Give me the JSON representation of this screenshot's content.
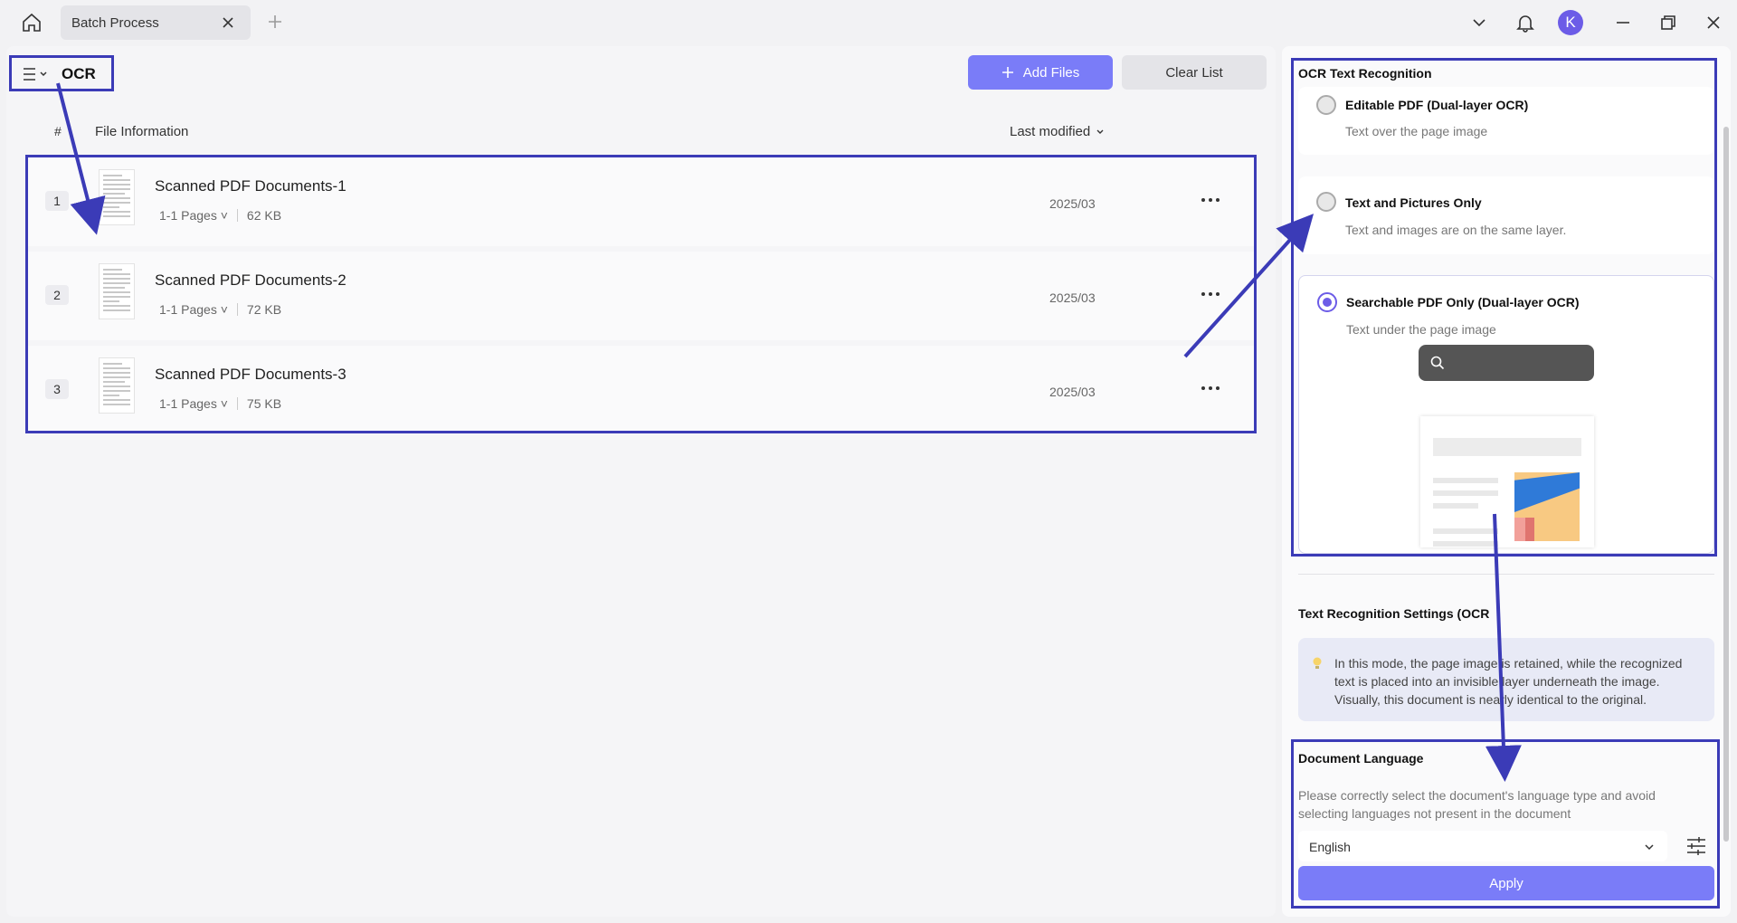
{
  "titlebar": {
    "tab_label": "Batch Process",
    "avatar_initial": "K"
  },
  "toolbar": {
    "mode_title": "OCR",
    "add_files_label": "Add Files",
    "clear_list_label": "Clear List"
  },
  "table": {
    "col_hash": "#",
    "col_info": "File Information",
    "col_modified": "Last modified"
  },
  "files": [
    {
      "num": "1",
      "name": "Scanned PDF Documents-1",
      "pages": "1-1 Pages",
      "size": "62 KB",
      "date": "2025/03"
    },
    {
      "num": "2",
      "name": "Scanned PDF Documents-2",
      "pages": "1-1 Pages",
      "size": "72 KB",
      "date": "2025/03"
    },
    {
      "num": "3",
      "name": "Scanned PDF Documents-3",
      "pages": "1-1 Pages",
      "size": "75 KB",
      "date": "2025/03"
    }
  ],
  "ocr_panel": {
    "title": "OCR Text Recognition",
    "options": [
      {
        "label": "Editable PDF (Dual-layer OCR)",
        "desc": "Text over the page image",
        "selected": false
      },
      {
        "label": "Text and Pictures Only",
        "desc": "Text and images are on the same layer.",
        "selected": false
      },
      {
        "label": "Searchable PDF Only (Dual-layer OCR)",
        "desc": "Text under the page image",
        "selected": true
      }
    ],
    "settings_title": "Text Recognition Settings (OCR",
    "tip": "In this mode, the page image is retained, while the recognized text is placed into an invisible layer underneath the image. Visually, this document is nearly identical to the original.",
    "language_title": "Document Language",
    "language_desc": "Please correctly select the document's language type and avoid selecting languages not present in the document",
    "language_value": "English",
    "apply_label": "Apply"
  },
  "colors": {
    "accent": "#7a7cf8",
    "annotation": "#3b3bb7",
    "selected_radio": "#6c5ce7"
  },
  "icons": [
    "home-icon",
    "close-icon",
    "plus-icon",
    "chevron-down-icon",
    "bell-icon",
    "minimize-icon",
    "restore-icon",
    "menu-icon",
    "more-icon",
    "search-icon",
    "bulb-icon",
    "settings-sliders-icon"
  ]
}
